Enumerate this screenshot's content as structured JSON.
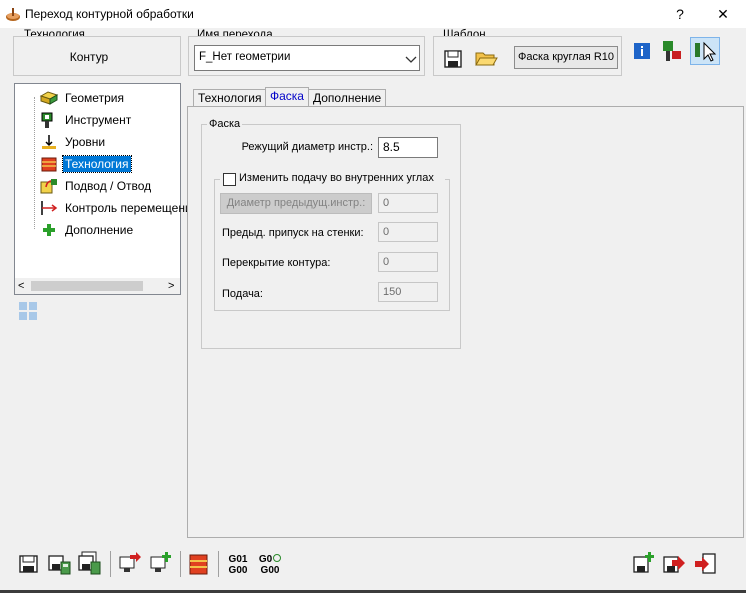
{
  "window": {
    "title": "Переход контурной обработки",
    "help_label": "?",
    "close_label": "✕"
  },
  "header": {
    "technology_group_label": "Технология",
    "technology_value": "Контур",
    "transition_group_label": "Имя перехода",
    "transition_name_value": "F_Нет геометрии",
    "template_group_label": "Шаблон",
    "template_button_label": "Фаска круглая R10"
  },
  "tree": {
    "items": [
      {
        "label": "Геометрия",
        "icon": "geometry-icon"
      },
      {
        "label": "Инструмент",
        "icon": "tool-icon"
      },
      {
        "label": "Уровни",
        "icon": "levels-icon"
      },
      {
        "label": "Технология",
        "icon": "technology-icon",
        "selected": true
      },
      {
        "label": "Подвод / Отвод",
        "icon": "approach-retract-icon"
      },
      {
        "label": "Контроль перемещений",
        "icon": "motion-control-icon"
      },
      {
        "label": "Дополнение",
        "icon": "plus-icon"
      }
    ]
  },
  "tabs": [
    {
      "label": "Технология"
    },
    {
      "label": "Фаска",
      "active": true
    },
    {
      "label": "Дополнение"
    }
  ],
  "chamfer": {
    "group_label": "Фаска",
    "cutting_diameter_label": "Режущий диаметр инстр.:",
    "cutting_diameter_value": "8.5",
    "change_feed_label": "Изменить подачу во внутренних углах",
    "prev_diameter_button": "Диаметр предыдущ.инстр.:",
    "prev_diameter_value": "0",
    "prev_allowance_label": "Предыд. припуск на стенки:",
    "prev_allowance_value": "0",
    "contour_overlap_label": "Перекрытие контура:",
    "contour_overlap_value": "0",
    "feed_label": "Подача:",
    "feed_value": "150"
  },
  "bottom_toolbar": {
    "g01_label": "G01",
    "g00_label": "G00",
    "g0_label": "G0",
    "g00b_label": "G00"
  },
  "colors": {
    "selection": "#0078d7",
    "active_tab_text": "#0000c8",
    "window_bg": "#f0f0f0"
  }
}
